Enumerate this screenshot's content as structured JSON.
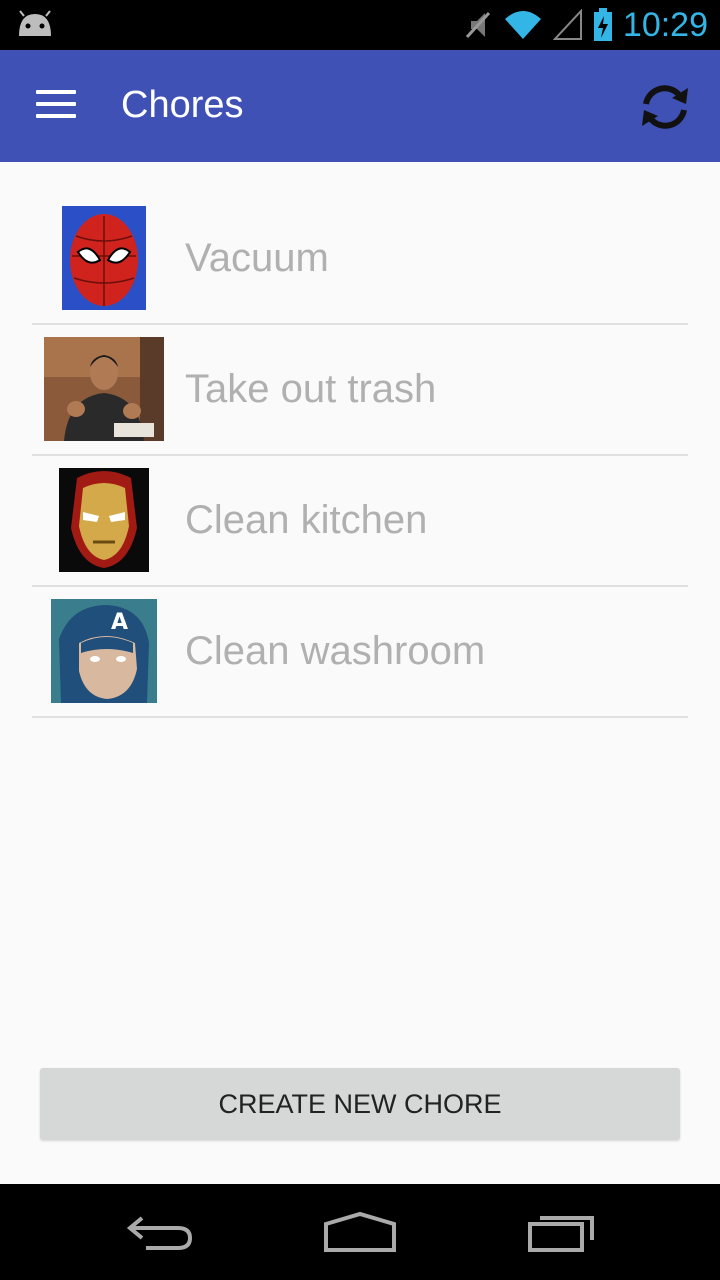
{
  "status_bar": {
    "time": "10:29",
    "icons": [
      "android-icon",
      "mute-icon",
      "wifi-icon",
      "signal-icon",
      "battery-charging-icon"
    ]
  },
  "app_bar": {
    "title": "Chores",
    "left_icon": "hamburger-menu-icon",
    "right_icon": "refresh-icon"
  },
  "chores": [
    {
      "label": "Vacuum",
      "avatar": "spiderman-avatar"
    },
    {
      "label": "Take out trash",
      "avatar": "person-photo-avatar"
    },
    {
      "label": "Clean kitchen",
      "avatar": "ironman-avatar"
    },
    {
      "label": "Clean washroom",
      "avatar": "captain-america-avatar"
    }
  ],
  "create_button": {
    "label": "CREATE NEW CHORE"
  },
  "nav_bar": {
    "icons": [
      "back-icon",
      "home-icon",
      "recent-apps-icon"
    ]
  },
  "colors": {
    "app_bar": "#3f51b5",
    "status_accent": "#33b5e5",
    "list_text": "#b0b0b0",
    "button_bg": "#d6d7d7"
  }
}
